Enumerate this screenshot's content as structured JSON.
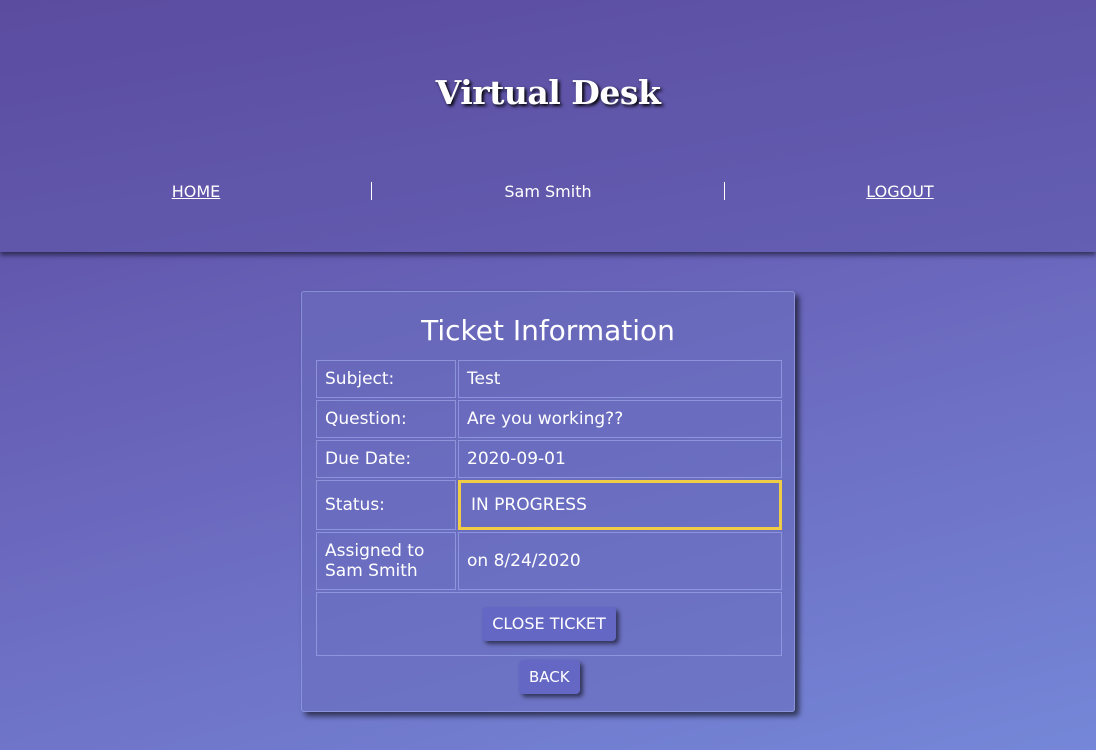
{
  "header": {
    "title": "Virtual Desk",
    "nav": {
      "home": "HOME",
      "user": "Sam Smith",
      "logout": "LOGOUT"
    }
  },
  "ticket": {
    "title": "Ticket Information",
    "subject_label": "Subject:",
    "subject_value": "Test",
    "question_label": "Question:",
    "question_value": "Are you working??",
    "due_label": "Due Date:",
    "due_value": "2020-09-01",
    "status_label": "Status:",
    "status_value": "IN PROGRESS",
    "assigned_label_line1": "Assigned to",
    "assigned_label_line2": "Sam Smith",
    "assigned_value": "on 8/24/2020",
    "close_button": "CLOSE TICKET",
    "back_button": "BACK"
  },
  "colors": {
    "status_highlight": "#f1cc47",
    "button_bg": "#6567c4"
  }
}
